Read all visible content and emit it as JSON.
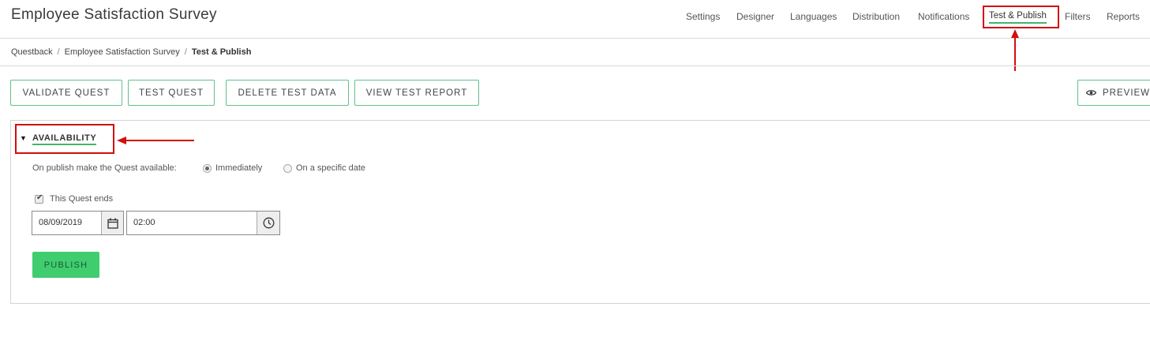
{
  "header": {
    "title": "Employee Satisfaction Survey",
    "nav": [
      {
        "label": "Settings"
      },
      {
        "label": "Designer"
      },
      {
        "label": "Languages"
      },
      {
        "label": "Distribution"
      },
      {
        "label": "Notifications"
      },
      {
        "label": "Test & Publish",
        "active": true
      },
      {
        "label": "Filters"
      },
      {
        "label": "Reports"
      }
    ]
  },
  "breadcrumb": {
    "items": [
      "Questback",
      "Employee Satisfaction Survey",
      "Test & Publish"
    ]
  },
  "toolbar": {
    "validate_label": "VALIDATE QUEST",
    "test_label": "TEST QUEST",
    "delete_label": "DELETE TEST DATA",
    "report_label": "VIEW TEST REPORT",
    "preview_label": "PREVIEW"
  },
  "availability": {
    "title": "AVAILABILITY",
    "toggle_glyph": "▼",
    "publish_prompt": "On publish make the Quest available:",
    "options": [
      {
        "label": "Immediately",
        "checked": true
      },
      {
        "label": "On a specific date",
        "checked": false
      }
    ],
    "ends_label": "This Quest ends",
    "ends_checked": true,
    "end_date": "08/09/2019",
    "end_time": "02:00",
    "publish_label": "PUBLISH"
  },
  "colors": {
    "accent_green": "#45b36b",
    "publish_green": "#3fcd6f",
    "annotation_red": "#d10e0e"
  },
  "icons": [
    "eye-icon",
    "calendar-icon",
    "clock-icon",
    "triangle-down-icon",
    "checkmark-icon"
  ]
}
